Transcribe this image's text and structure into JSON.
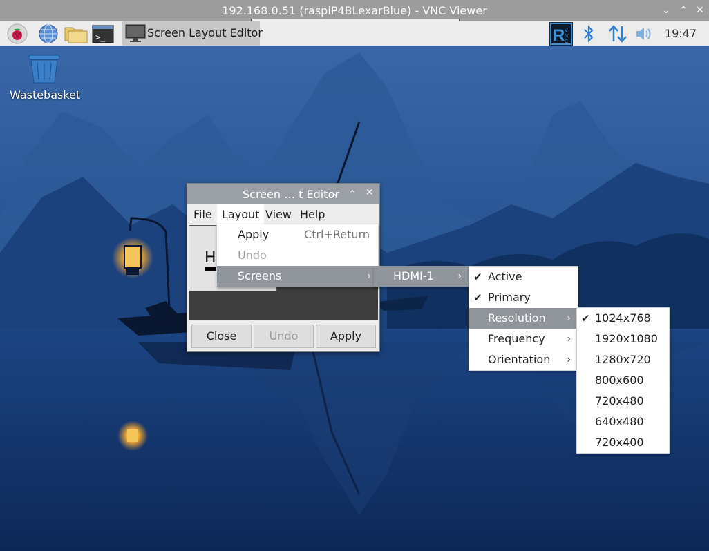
{
  "vnc": {
    "title": "192.168.0.51 (raspiP4BLexarBlue) - VNC Viewer",
    "controls": [
      "⌄",
      "⌃",
      "✕"
    ]
  },
  "panel": {
    "task_label": "Screen Layout Editor",
    "clock": "19:47",
    "icons": [
      "raspberry-menu-icon",
      "web-browser-icon",
      "file-manager-icon",
      "terminal-icon",
      "vnc-server-icon",
      "bluetooth-icon",
      "network-icon",
      "volume-icon"
    ]
  },
  "desktop": {
    "wastebasket_label": "Wastebasket"
  },
  "window": {
    "title": "Screen … t Editor",
    "menus": [
      "File",
      "Layout",
      "View",
      "Help"
    ],
    "monitor_label": "H",
    "buttons": {
      "close": "Close",
      "undo": "Undo",
      "apply": "Apply"
    }
  },
  "layout_menu": {
    "apply": "Apply",
    "apply_shortcut": "Ctrl+Return",
    "undo": "Undo",
    "screens": "Screens"
  },
  "screens_menu": {
    "hdmi": "HDMI-1"
  },
  "hdmi_menu": {
    "active": "Active",
    "primary": "Primary",
    "resolution": "Resolution",
    "frequency": "Frequency",
    "orientation": "Orientation"
  },
  "resolutions": [
    "1024x768",
    "1920x1080",
    "1280x720",
    "800x600",
    "720x480",
    "640x480",
    "720x400"
  ],
  "selected_resolution": "1024x768",
  "glyphs": {
    "check": "✔",
    "submenu": "›"
  }
}
